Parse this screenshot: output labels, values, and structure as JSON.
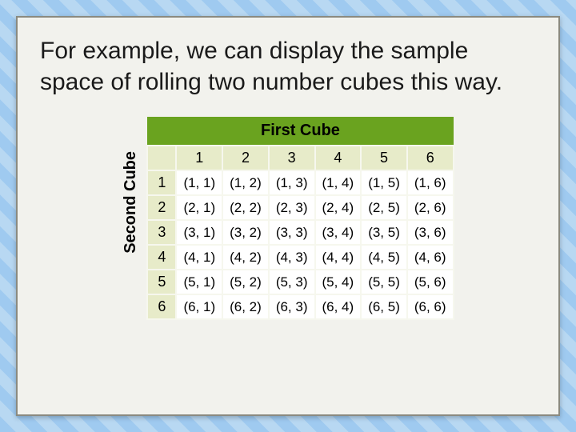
{
  "title": "For example, we can display the sample space of rolling two number cubes this way.",
  "first_cube_label": "First Cube",
  "second_cube_label": "Second Cube",
  "col_headers": [
    "1",
    "2",
    "3",
    "4",
    "5",
    "6"
  ],
  "row_headers": [
    "1",
    "2",
    "3",
    "4",
    "5",
    "6"
  ],
  "chart_data": {
    "type": "table",
    "title": "Sample space of rolling two number cubes",
    "xlabel": "First Cube",
    "ylabel": "Second Cube",
    "columns": [
      "1",
      "2",
      "3",
      "4",
      "5",
      "6"
    ],
    "rows": [
      "1",
      "2",
      "3",
      "4",
      "5",
      "6"
    ],
    "cells": [
      [
        "(1, 1)",
        "(1, 2)",
        "(1, 3)",
        "(1, 4)",
        "(1, 5)",
        "(1, 6)"
      ],
      [
        "(2, 1)",
        "(2, 2)",
        "(2, 3)",
        "(2, 4)",
        "(2, 5)",
        "(2, 6)"
      ],
      [
        "(3, 1)",
        "(3, 2)",
        "(3, 3)",
        "(3, 4)",
        "(3, 5)",
        "(3, 6)"
      ],
      [
        "(4, 1)",
        "(4, 2)",
        "(4, 3)",
        "(4, 4)",
        "(4, 5)",
        "(4, 6)"
      ],
      [
        "(5, 1)",
        "(5, 2)",
        "(5, 3)",
        "(5, 4)",
        "(5, 5)",
        "(5, 6)"
      ],
      [
        "(6, 1)",
        "(6, 2)",
        "(6, 3)",
        "(6, 4)",
        "(6, 5)",
        "(6, 6)"
      ]
    ]
  }
}
